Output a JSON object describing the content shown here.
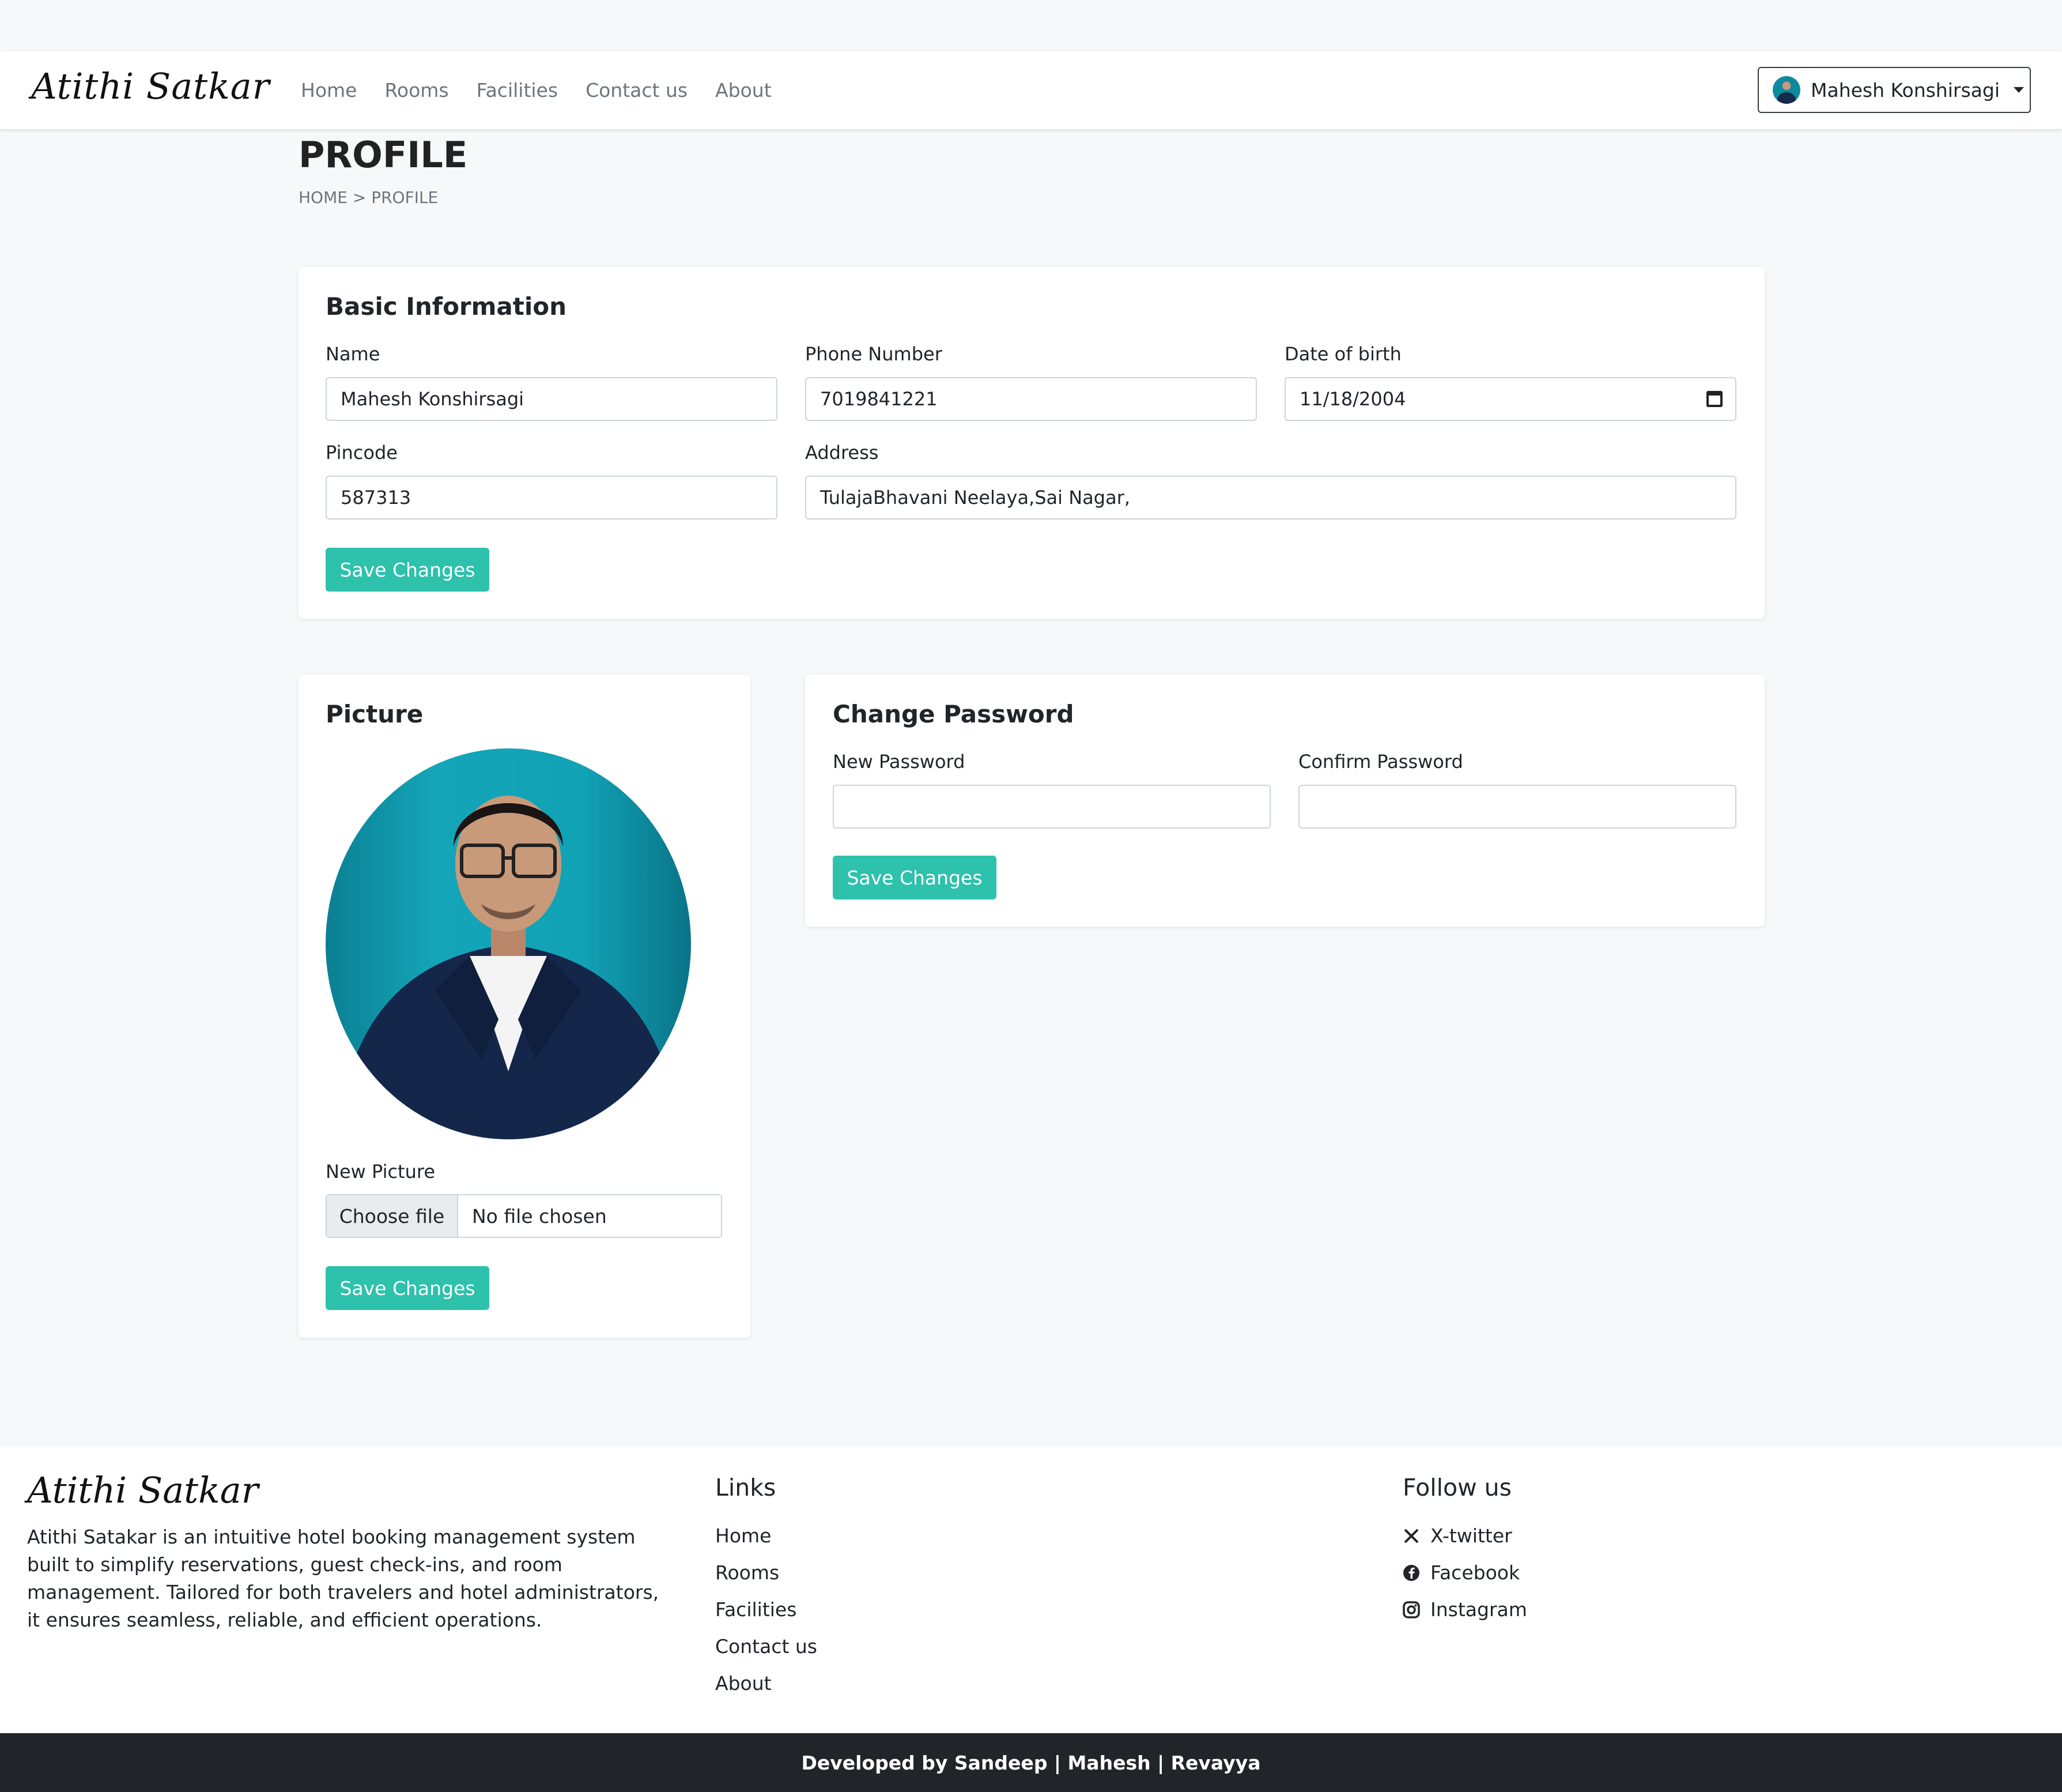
{
  "nav": {
    "brand": "Atithi Satkar",
    "links": [
      "Home",
      "Rooms",
      "Facilities",
      "Contact us",
      "About"
    ],
    "user": "Mahesh Konshirsagi"
  },
  "header": {
    "title": "PROFILE",
    "breadcrumb": "HOME > PROFILE"
  },
  "basic": {
    "title": "Basic Information",
    "name_label": "Name",
    "name_value": "Mahesh Konshirsagi",
    "phone_label": "Phone Number",
    "phone_value": "7019841221",
    "dob_label": "Date of birth",
    "dob_value": "11/18/2004",
    "pincode_label": "Pincode",
    "pincode_value": "587313",
    "address_label": "Address",
    "address_value": "TulajaBhavani Neelaya,Sai Nagar,",
    "save_label": "Save Changes"
  },
  "picture": {
    "title": "Picture",
    "new_label": "New Picture",
    "choose_label": "Choose file",
    "no_file": "No file chosen",
    "save_label": "Save Changes"
  },
  "password": {
    "title": "Change Password",
    "new_label": "New Password",
    "confirm_label": "Confirm Password",
    "save_label": "Save Changes"
  },
  "footer": {
    "brand": "Atithi Satkar",
    "description": "Atithi Satakar is an intuitive hotel booking management system built to simplify reservations, guest check-ins, and room management. Tailored for both travelers and hotel administrators, it ensures seamless, reliable, and efficient operations.",
    "links_title": "Links",
    "links": [
      "Home",
      "Rooms",
      "Facilities",
      "Contact us",
      "About"
    ],
    "follow_title": "Follow us",
    "social": [
      "X-twitter",
      "Facebook",
      "Instagram"
    ],
    "credit": "Developed by Sandeep | Mahesh | Revayya"
  },
  "colors": {
    "accent": "#2ec1ac",
    "dark": "#212529",
    "background": "#f7f8fa"
  }
}
